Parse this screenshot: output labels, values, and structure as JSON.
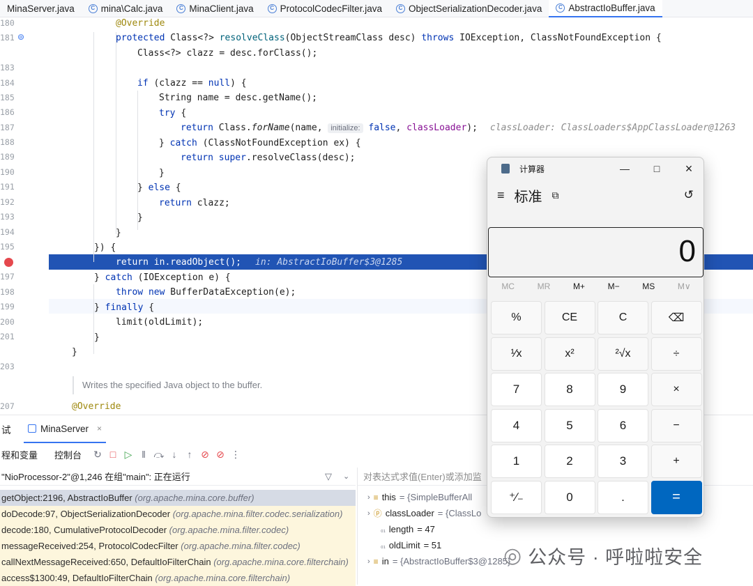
{
  "tabs": [
    {
      "label": "MinaServer.java"
    },
    {
      "label": "mina\\Calc.java"
    },
    {
      "label": "MinaClient.java"
    },
    {
      "label": "ProtocolCodecFilter.java"
    },
    {
      "label": "ObjectSerializationDecoder.java"
    },
    {
      "label": "AbstractIoBuffer.java"
    }
  ],
  "editor": {
    "lines": [
      "180",
      "181",
      "183",
      "184",
      "185",
      "186",
      "187",
      "188",
      "189",
      "190",
      "191",
      "192",
      "193",
      "194",
      "195",
      "196",
      "197",
      "198",
      "199",
      "200",
      "201",
      "203",
      "",
      "207"
    ],
    "code": {
      "l180": "@Override",
      "l181a": "protected ",
      "l181b": "Class<?> ",
      "l181c": "resolveClass",
      "l181d": "(ObjectStreamClass desc) ",
      "l181e": "throws ",
      "l181f": "IOException, ClassNotFoundException {",
      "l182": "Class<?> clazz = desc.forClass();",
      "l184a": "if ",
      "l184b": "(clazz == ",
      "l184c": "null",
      "l184d": ") {",
      "l185": "String name = desc.getName();",
      "l186a": "try ",
      "l186b": "{",
      "l187a": "return ",
      "l187b": "Class.",
      "l187c": "forName",
      "l187d": "(name, ",
      "l187e": "initialize:",
      "l187f": " false",
      "l187g": ", ",
      "l187h": "classLoader",
      "l187i": ");",
      "l187hint": "classLoader: ClassLoaders$AppClassLoader@1263",
      "l188a": "} ",
      "l188b": "catch ",
      "l188c": "(ClassNotFoundException ex) {",
      "l189a": "return ",
      "l189b": "super",
      "l189c": ".resolveClass(desc);",
      "l190": "}",
      "l191a": "} ",
      "l191b": "else ",
      "l191c": "{",
      "l192a": "return ",
      "l192b": "clazz;",
      "l193": "}",
      "l194": "}",
      "l195": "}) {",
      "l196a": "return in.readObject();",
      "l196hint": "in: AbstractIoBuffer$3@1285",
      "l197a": "} ",
      "l197b": "catch ",
      "l197c": "(IOException e) {",
      "l198a": "throw new ",
      "l198b": "BufferDataException(e);",
      "l199a": "} ",
      "l199b": "finally ",
      "l199c": "{",
      "l200": "limit(oldLimit);",
      "l201": "}",
      "l202": "}",
      "doc": "Writes the specified Java object to the buffer.",
      "l207": "@Override"
    }
  },
  "debug": {
    "panel_label": "试",
    "run_config": "MinaServer",
    "tab_frames": "程和变量",
    "tab_console": "控制台",
    "thread": "\"NioProcessor-2\"@1,246 在组\"main\": 正在运行",
    "frames": [
      {
        "method": "getObject:2196, AbstractIoBuffer",
        "pkg": "(org.apache.mina.core.buffer)"
      },
      {
        "method": "doDecode:97, ObjectSerializationDecoder",
        "pkg": "(org.apache.mina.filter.codec.serialization)"
      },
      {
        "method": "decode:180, CumulativeProtocolDecoder",
        "pkg": "(org.apache.mina.filter.codec)"
      },
      {
        "method": "messageReceived:254, ProtocolCodecFilter",
        "pkg": "(org.apache.mina.filter.codec)"
      },
      {
        "method": "callNextMessageReceived:650, DefaultIoFilterChain",
        "pkg": "(org.apache.mina.core.filterchain)"
      },
      {
        "method": "access$1300:49, DefaultIoFilterChain",
        "pkg": "(org.apache.mina.core.filterchain)"
      }
    ],
    "expr_placeholder": "对表达式求值(Enter)或添加监",
    "vars": [
      {
        "name": "this",
        "value": "= {SimpleBufferAll"
      },
      {
        "name": "classLoader",
        "value": "= {ClassLo"
      },
      {
        "name": "length",
        "value": "= 47"
      },
      {
        "name": "oldLimit",
        "value": "= 51"
      },
      {
        "name": "in",
        "value": "= {AbstractIoBuffer$3@1285}"
      }
    ]
  },
  "calc": {
    "title": "计算器",
    "mode": "标准",
    "display": "0",
    "memory": [
      "MC",
      "MR",
      "M+",
      "M−",
      "MS",
      "M∨"
    ],
    "keys": [
      {
        "label": "%",
        "kind": "fn"
      },
      {
        "label": "CE",
        "kind": "fn"
      },
      {
        "label": "C",
        "kind": "fn"
      },
      {
        "label": "⌫",
        "kind": "fn"
      },
      {
        "label": "¹⁄x",
        "kind": "fn"
      },
      {
        "label": "x²",
        "kind": "fn"
      },
      {
        "label": "²√x",
        "kind": "fn"
      },
      {
        "label": "÷",
        "kind": "fn"
      },
      {
        "label": "7",
        "kind": "num"
      },
      {
        "label": "8",
        "kind": "num"
      },
      {
        "label": "9",
        "kind": "num"
      },
      {
        "label": "×",
        "kind": "fn"
      },
      {
        "label": "4",
        "kind": "num"
      },
      {
        "label": "5",
        "kind": "num"
      },
      {
        "label": "6",
        "kind": "num"
      },
      {
        "label": "−",
        "kind": "fn"
      },
      {
        "label": "1",
        "kind": "num"
      },
      {
        "label": "2",
        "kind": "num"
      },
      {
        "label": "3",
        "kind": "num"
      },
      {
        "label": "+",
        "kind": "fn"
      },
      {
        "label": "⁺∕₋",
        "kind": "num"
      },
      {
        "label": "0",
        "kind": "num"
      },
      {
        "label": ".",
        "kind": "num"
      },
      {
        "label": "=",
        "kind": "eq"
      }
    ]
  },
  "watermark": "公众号 · 呼啦啦安全",
  "colors": {
    "accent": "#0067c0",
    "highlight": "#2154b4",
    "breakpoint": "#e5484d"
  }
}
